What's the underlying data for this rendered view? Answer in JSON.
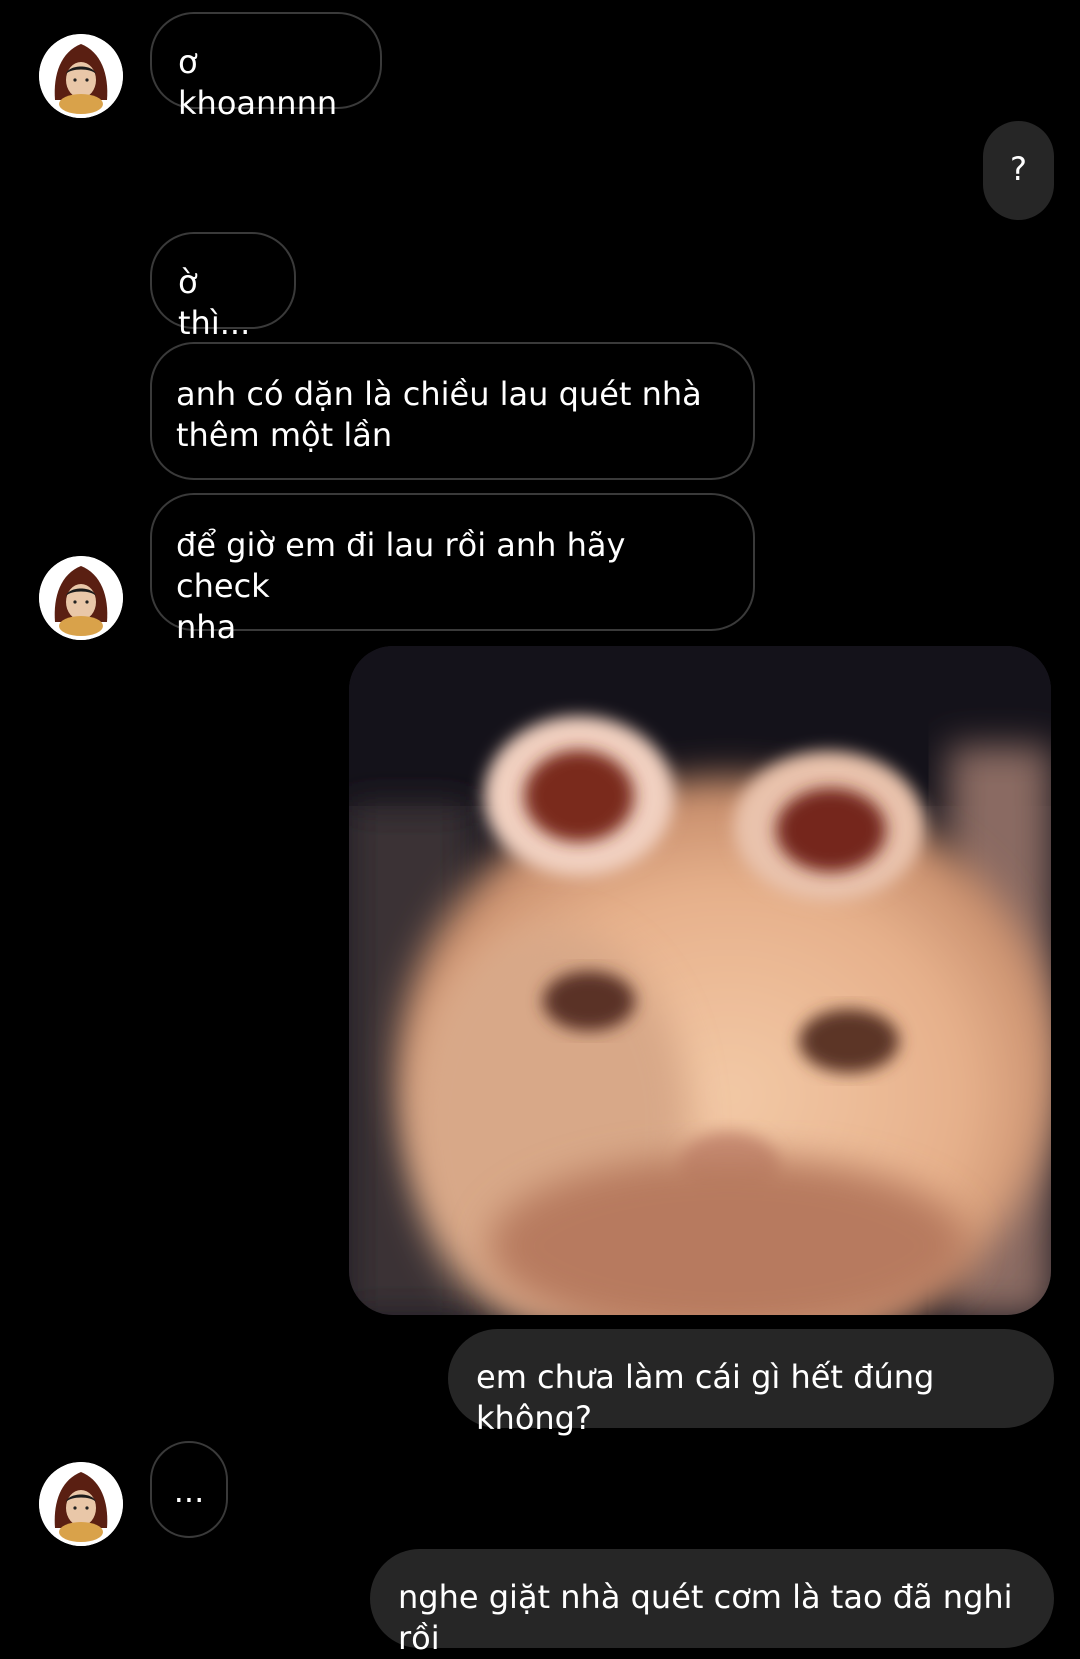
{
  "conversation": {
    "messages": [
      {
        "sender": "them",
        "text": "ơ khoannnn"
      },
      {
        "sender": "me",
        "text": "?"
      },
      {
        "sender": "them",
        "text": "ờ thì..."
      },
      {
        "sender": "them",
        "text": "anh có dặn là chiều lau quét nhà\nthêm một lần"
      },
      {
        "sender": "them",
        "text": "để giờ em đi lau rồi anh hãy check\nnha"
      },
      {
        "sender": "me",
        "type": "image",
        "icon": "cat-face-photo"
      },
      {
        "sender": "me",
        "text": "em chưa làm cái gì hết đúng không?"
      },
      {
        "sender": "them",
        "text": "..."
      },
      {
        "sender": "me",
        "text": "nghe giặt nhà quét cơm là tao đã nghi rồi"
      }
    ]
  },
  "colors": {
    "background": "#000000",
    "incoming_border": "#3a3a3a",
    "outgoing_bubble": "#262626",
    "text": "#ffffff"
  }
}
